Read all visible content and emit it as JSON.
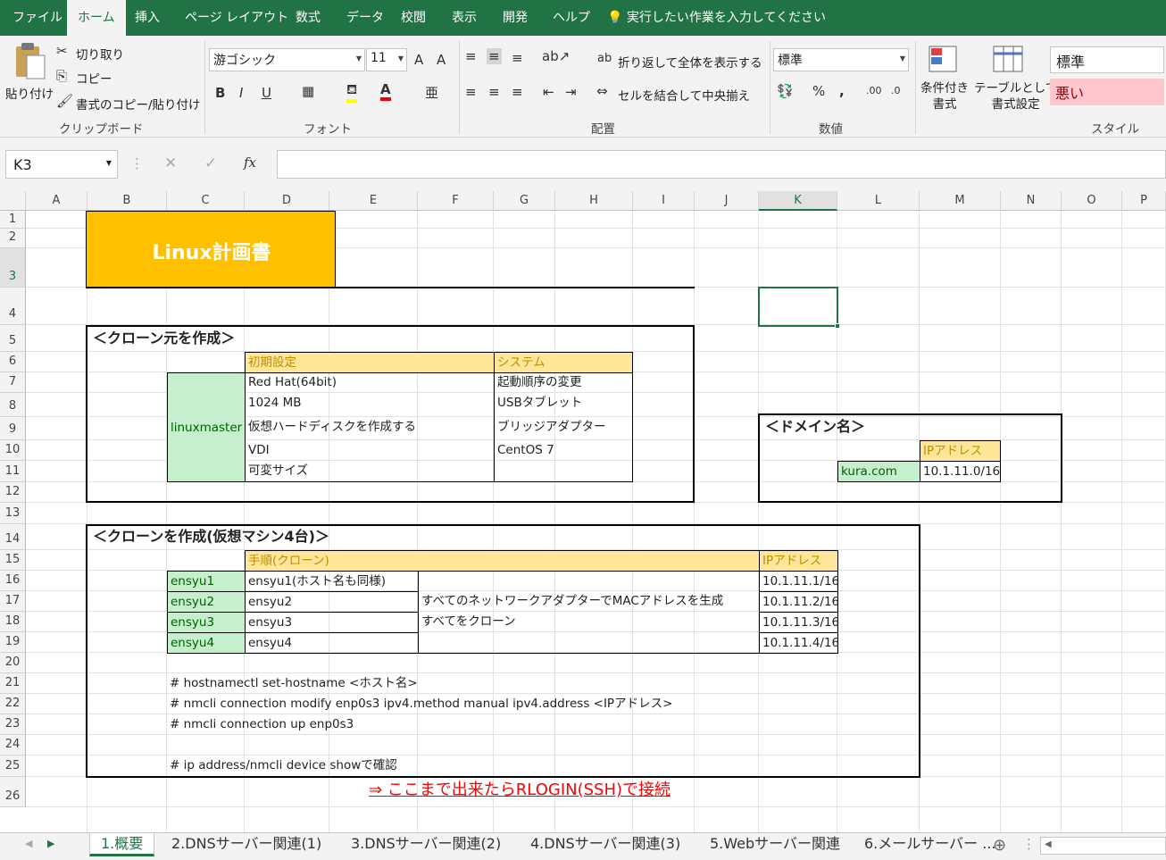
{
  "menu": {
    "tabs": [
      "ファイル",
      "ホーム",
      "挿入",
      "ページ レイアウト",
      "数式",
      "データ",
      "校閲",
      "表示",
      "開発",
      "ヘルプ"
    ],
    "tell_me": "実行したい作業を入力してください"
  },
  "ribbon": {
    "clipboard": {
      "paste": "貼り付け",
      "cut": "切り取り",
      "copy": "コピー",
      "format_painter": "書式のコピー/貼り付け",
      "label": "クリップボード"
    },
    "font": {
      "name": "游ゴシック",
      "size": "11",
      "label": "フォント"
    },
    "alignment": {
      "wrap": "折り返して全体を表示する",
      "merge": "セルを結合して中央揃え",
      "label": "配置"
    },
    "number": {
      "format": "標準",
      "label": "数値"
    },
    "styles": {
      "conditional": "条件付き\n書式",
      "table": "テーブルとして\n書式設定",
      "normal": "標準",
      "bad": "悪い",
      "label": "スタイル"
    }
  },
  "formula_bar": {
    "name_box": "K3",
    "formula": ""
  },
  "columns": [
    "A",
    "B",
    "C",
    "D",
    "E",
    "F",
    "G",
    "H",
    "I",
    "J",
    "K",
    "L",
    "M",
    "N",
    "O",
    "P"
  ],
  "rows": [
    "1",
    "2",
    "3",
    "4",
    "5",
    "6",
    "7",
    "8",
    "9",
    "10",
    "11",
    "12",
    "13",
    "14",
    "15",
    "16",
    "17",
    "18",
    "19",
    "20",
    "21",
    "22",
    "23",
    "24",
    "25",
    "26"
  ],
  "sheet": {
    "title": "Linux計画書",
    "section1": {
      "heading": "＜クローン元を作成＞",
      "hdr_initial": "初期設定",
      "hdr_system": "システム",
      "vm_name": "linuxmaster",
      "initial": [
        "Red Hat(64bit)",
        "1024 MB",
        "仮想ハードディスクを作成する",
        "VDI",
        "可変サイズ"
      ],
      "system": [
        "起動順序の変更",
        "USBタブレット",
        "ブリッジアダプター",
        "CentOS 7",
        ""
      ]
    },
    "domain": {
      "heading": "＜ドメイン名＞",
      "hdr_ip": "IPアドレス",
      "name": "kura.com",
      "ip": "10.1.11.0/16"
    },
    "section2": {
      "heading": "＜クローンを作成(仮想マシン4台)＞",
      "hdr_proc": "手順(クローン)",
      "hdr_ip": "IPアドレス",
      "hosts": [
        "ensyu1",
        "ensyu2",
        "ensyu3",
        "ensyu4"
      ],
      "procs": [
        "ensyu1(ホスト名も同様)",
        "ensyu2",
        "ensyu3",
        "ensyu4"
      ],
      "note1": "すべてのネットワークアダプターでMACアドレスを生成",
      "note2": "すべてをクローン",
      "ips": [
        "10.1.11.1/16",
        "10.1.11.2/16",
        "10.1.11.3/16",
        "10.1.11.4/16"
      ],
      "cmd1": "# hostnamectl set-hostname <ホスト名>",
      "cmd2": "# nmcli connection modify enp0s3 ipv4.method manual ipv4.address <IPアドレス>",
      "cmd3": "# nmcli connection up enp0s3",
      "cmd4": "# ip address/nmcli device showで確認"
    },
    "link": "⇒ ここまで出来たらRLOGIN(SSH)で接続"
  },
  "sheet_tabs": [
    "1.概要",
    "2.DNSサーバー関連(1)",
    "3.DNSサーバー関連(2)",
    "4.DNSサーバー関連(3)",
    "5.Webサーバー関連",
    "6.メールサーバー ..."
  ],
  "colors": {
    "excel_green": "#217346",
    "header_yellow": "#ffe699",
    "cell_green": "#c6efce",
    "title_orange": "#ffc000",
    "link_red": "#ff0000"
  }
}
